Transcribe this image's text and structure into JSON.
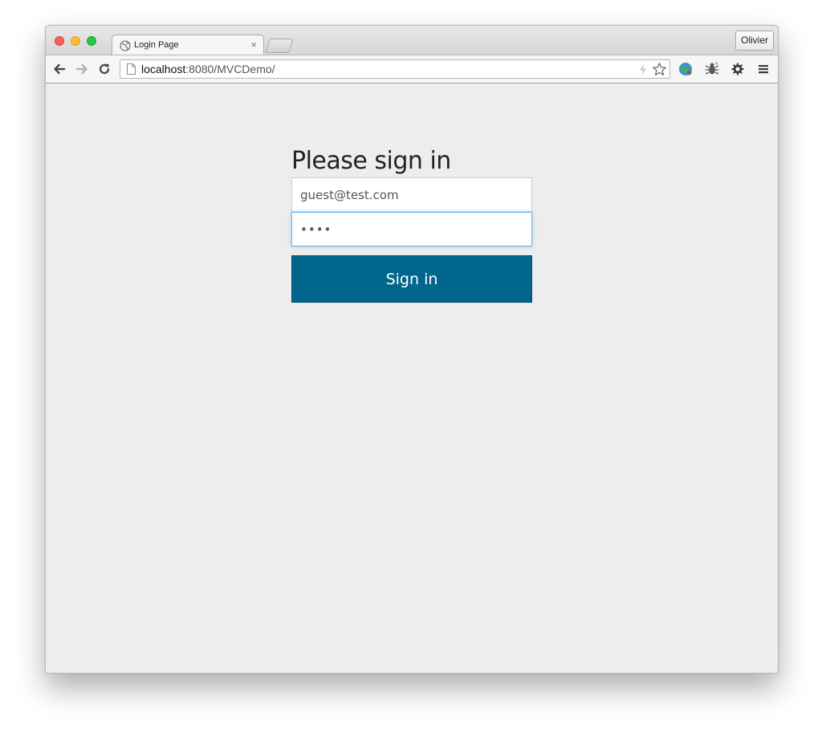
{
  "window": {
    "tab_title": "Login Page",
    "tab_close": "×",
    "profile_name": "Olivier"
  },
  "toolbar": {
    "url_host": "localhost",
    "url_rest": ":8080/MVCDemo/"
  },
  "signin": {
    "heading": "Please sign in",
    "email_value": "guest@test.com",
    "password_value": "test",
    "button_label": "Sign in"
  },
  "colors": {
    "button_bg": "#00668c",
    "page_bg": "#ededed",
    "focus_border": "#66afe9"
  },
  "icons": [
    "back-arrow-icon",
    "forward-arrow-icon",
    "reload-icon",
    "page-icon",
    "bolt-icon",
    "star-icon",
    "globe-extension-icon",
    "bug-extension-icon",
    "gear-icon",
    "hamburger-menu-icon"
  ]
}
